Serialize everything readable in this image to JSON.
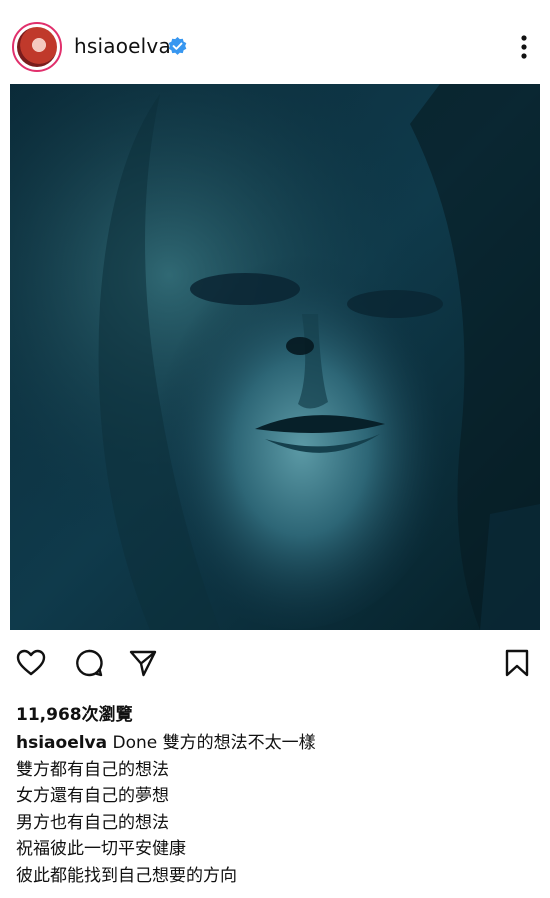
{
  "post": {
    "username": "hsiaoelva",
    "views": "11,968次瀏覽",
    "caption_first": "Done 雙方的想法不太一樣",
    "caption_lines": [
      "雙方都有自己的想法",
      "女方還有自己的夢想",
      "男方也有自己的想法",
      "祝福彼此一切平安健康",
      "彼此都能找到自己想要的方向"
    ]
  },
  "icons": {
    "header": [
      "avatar",
      "verified-badge-icon",
      "more-options-icon"
    ],
    "actions": [
      "heart-icon",
      "comment-icon",
      "share-icon",
      "bookmark-icon"
    ]
  },
  "colors": {
    "verified": "#3897f0",
    "avatar_ring": "#e1306c",
    "photo_tone": "#0b2a3a"
  }
}
